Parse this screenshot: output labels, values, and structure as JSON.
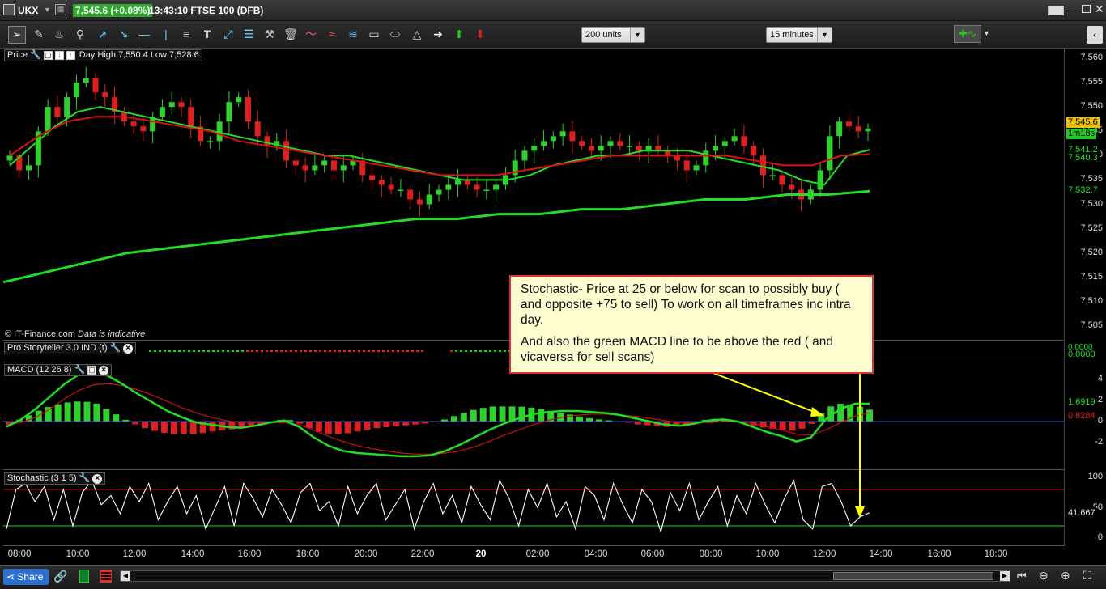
{
  "titlebar": {
    "symbol": "UKX",
    "quote": "7,545.6 (+0.08%)",
    "info": "13:43:10 FTSE 100 (DFB)"
  },
  "toolbar": {
    "units_select": "200 units",
    "interval_select": "15 minutes"
  },
  "price_panel": {
    "label": "Price",
    "dayrange": "Day:High 7,550.4 Low 7,528.6",
    "watermark": "© IT-Finance.com",
    "disclaimer": "Data is indicative",
    "ticks": [
      "7,560",
      "7,555",
      "7,550",
      "7,545",
      "7,540",
      "7,535",
      "7,530",
      "7,525",
      "7,520",
      "7,515",
      "7,510",
      "7,505"
    ],
    "tags": {
      "last": "7,545.6",
      "timer": "1m18s",
      "ma1": "7,541.2",
      "ma2": "7,540.3",
      "ma3": "7,532.7"
    }
  },
  "storyteller_panel": {
    "label": "Pro Storyteller 3.0 IND (t)",
    "values": [
      "0.0000",
      "0.0000"
    ]
  },
  "macd_panel": {
    "label": "MACD (12 26 8)",
    "ticks": [
      "4",
      "2",
      "0",
      "-2"
    ],
    "tags": {
      "macd": "1.6919",
      "signal": "0.8284"
    }
  },
  "stoch_panel": {
    "label": "Stochastic (3 1 5)",
    "ticks": [
      "100",
      "50",
      "0"
    ],
    "tags": {
      "value": "41.667"
    }
  },
  "xaxis": [
    "08:00",
    "10:00",
    "12:00",
    "14:00",
    "16:00",
    "18:00",
    "20:00",
    "22:00",
    "20",
    "02:00",
    "04:00",
    "06:00",
    "08:00",
    "10:00",
    "12:00",
    "14:00",
    "16:00",
    "18:00"
  ],
  "callout": {
    "line1": "Stochastic- Price at 25 or below for scan to possibly buy ( and opposite +75 to sell) To work on all timeframes inc intra day.",
    "line2": "And also the green MACD line to be above the red ( and vicaversa for sell scans)"
  },
  "statusbar": {
    "share": "Share"
  },
  "colors": {
    "up": "#2fd12f",
    "down": "#e02020",
    "ma_green": "#22dd22",
    "ma_red": "#dd1111",
    "macd_line": "#22dd22",
    "signal_line": "#cc1111"
  },
  "chart_data": {
    "type": "candlestick",
    "title": "FTSE 100 (DFB)",
    "interval": "15 minutes",
    "ylim_price": [
      7503,
      7561
    ],
    "ylim_macd": [
      -4,
      5
    ],
    "ylim_stoch": [
      0,
      100
    ],
    "stoch_levels": [
      80,
      20
    ],
    "last_price": 7545.6,
    "day_high": 7550.4,
    "day_low": 7528.6,
    "ma_values": [
      7541.2,
      7540.3,
      7532.7
    ],
    "macd": 1.6919,
    "signal": 0.8284,
    "stochastic": 41.667,
    "series": [
      {
        "name": "Price",
        "close": [
          7540,
          7537,
          7538,
          7545,
          7550,
          7548,
          7552,
          7555,
          7556,
          7553,
          7552,
          7549,
          7547,
          7546,
          7545,
          7548,
          7550,
          7551,
          7550,
          7546,
          7543,
          7543,
          7547,
          7551,
          7552,
          7547,
          7544,
          7542,
          7543,
          7539,
          7538,
          7537,
          7538,
          7539,
          7537,
          7538,
          7539,
          7536,
          7535,
          7534,
          7533,
          7533,
          7531,
          7530,
          7532,
          7533,
          7534,
          7535,
          7534,
          7533,
          7533,
          7534,
          7536,
          7539,
          7541,
          7542,
          7543,
          7544,
          7545,
          7543,
          7542,
          7541,
          7542,
          7543,
          7542,
          7542,
          7541,
          7542,
          7541,
          7540,
          7539,
          7537,
          7538,
          7541,
          7542,
          7543,
          7544,
          7542,
          7540,
          7536,
          7536,
          7534,
          7533,
          7531,
          7533,
          7537,
          7544,
          7547,
          7546,
          7545,
          7545.6
        ]
      },
      {
        "name": "EMA fast",
        "values": [
          7538,
          7542,
          7546,
          7549,
          7550,
          7549,
          7548,
          7547,
          7546,
          7545,
          7544,
          7543,
          7542,
          7541,
          7540,
          7540,
          7539,
          7538,
          7537,
          7536,
          7535,
          7535,
          7535,
          7536,
          7538,
          7539,
          7540,
          7540,
          7541,
          7541,
          7541,
          7540,
          7539,
          7538,
          7537,
          7535,
          7534,
          7540,
          7541.2
        ]
      },
      {
        "name": "EMA slow",
        "values": [
          7540,
          7544,
          7547,
          7548,
          7548,
          7547,
          7546,
          7545,
          7543,
          7542,
          7541,
          7540,
          7539,
          7538,
          7537,
          7536,
          7536,
          7536,
          7537,
          7538,
          7539,
          7540,
          7540,
          7540,
          7540,
          7540,
          7539,
          7538,
          7538,
          7540,
          7540.3
        ]
      },
      {
        "name": "MA long",
        "values": [
          7514,
          7516,
          7518,
          7520,
          7521,
          7522,
          7523,
          7524,
          7525,
          7526,
          7527,
          7527,
          7528,
          7528,
          7529,
          7529,
          7530,
          7531,
          7531,
          7532,
          7532,
          7532.7
        ]
      }
    ]
  }
}
